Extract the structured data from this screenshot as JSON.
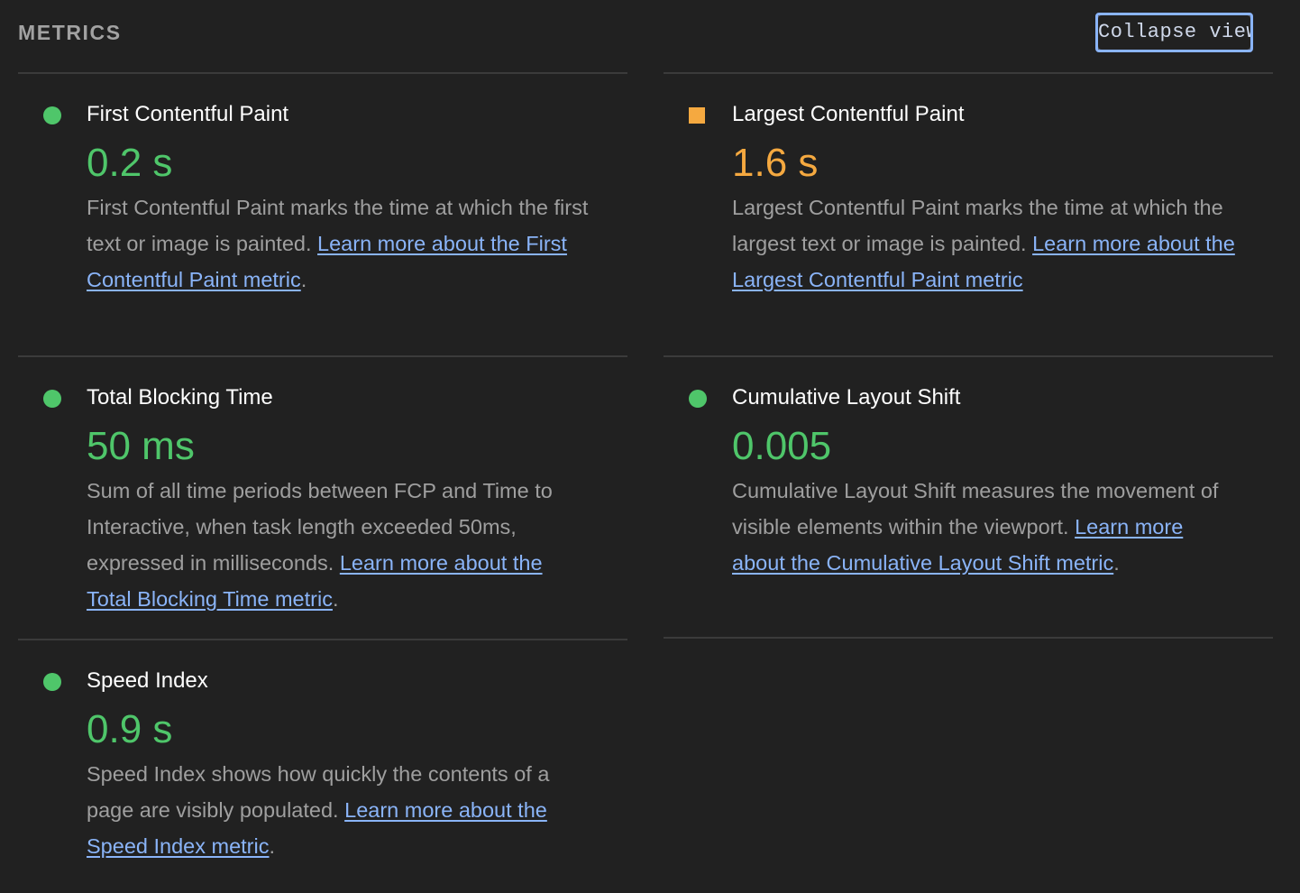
{
  "header": {
    "title": "METRICS",
    "collapse_label": "Collapse view"
  },
  "colors": {
    "pass": "#4fc66a",
    "average": "#f5a940",
    "link": "#8ab4f8"
  },
  "metrics": [
    {
      "title": "First Contentful Paint",
      "value": "0.2 s",
      "status": "pass",
      "indicator_icon": "green-circle-icon",
      "description": "First Contentful Paint marks the time at which the first text or image is painted.",
      "link_text": "Learn more about the First Contentful Paint metric",
      "suffix": "."
    },
    {
      "title": "Largest Contentful Paint",
      "value": "1.6 s",
      "status": "average",
      "indicator_icon": "orange-square-icon",
      "description": "Largest Contentful Paint marks the time at which the largest text or image is painted.",
      "link_text": "Learn more about the Largest Contentful Paint metric",
      "suffix": ""
    },
    {
      "title": "Total Blocking Time",
      "value": "50 ms",
      "status": "pass",
      "indicator_icon": "green-circle-icon",
      "description": "Sum of all time periods between FCP and Time to Interactive, when task length exceeded 50ms, expressed in milliseconds.",
      "link_text": "Learn more about the Total Blocking Time metric",
      "suffix": "."
    },
    {
      "title": "Cumulative Layout Shift",
      "value": "0.005",
      "status": "pass",
      "indicator_icon": "green-circle-icon",
      "description": "Cumulative Layout Shift measures the movement of visible elements within the viewport.",
      "link_text": "Learn more about the Cumulative Layout Shift metric",
      "suffix": "."
    },
    {
      "title": "Speed Index",
      "value": "0.9 s",
      "status": "pass",
      "indicator_icon": "green-circle-icon",
      "description": "Speed Index shows how quickly the contents of a page are visibly populated.",
      "link_text": "Learn more about the Speed Index metric",
      "suffix": "."
    }
  ]
}
